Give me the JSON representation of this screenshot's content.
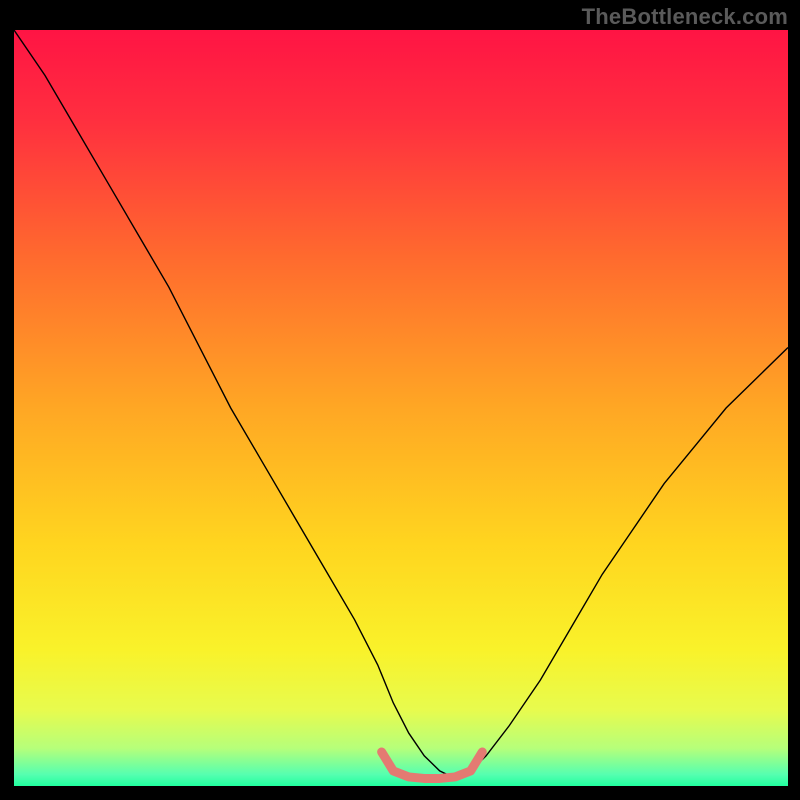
{
  "watermark": "TheBottleneck.com",
  "chart_data": {
    "type": "line",
    "title": "",
    "xlabel": "",
    "ylabel": "",
    "xlim": [
      0,
      100
    ],
    "ylim": [
      0,
      100
    ],
    "legend": null,
    "grid": false,
    "background_gradient": {
      "orientation": "vertical",
      "stops": [
        {
          "offset": 0.0,
          "color": "#ff1444"
        },
        {
          "offset": 0.12,
          "color": "#ff2f3f"
        },
        {
          "offset": 0.3,
          "color": "#ff6a2e"
        },
        {
          "offset": 0.5,
          "color": "#ffa724"
        },
        {
          "offset": 0.68,
          "color": "#ffd51f"
        },
        {
          "offset": 0.82,
          "color": "#f9f22a"
        },
        {
          "offset": 0.9,
          "color": "#e7fb4e"
        },
        {
          "offset": 0.95,
          "color": "#b6ff7a"
        },
        {
          "offset": 0.985,
          "color": "#55ffb0"
        },
        {
          "offset": 1.0,
          "color": "#21ff9f"
        }
      ]
    },
    "series": [
      {
        "name": "bottleneck-curve",
        "color": "#000000",
        "stroke_width": 1.4,
        "x": [
          0,
          4,
          8,
          12,
          16,
          20,
          24,
          28,
          32,
          36,
          40,
          44,
          47,
          49,
          51,
          53,
          55,
          57,
          59,
          61,
          64,
          68,
          72,
          76,
          80,
          84,
          88,
          92,
          96,
          100
        ],
        "values": [
          100,
          94,
          87,
          80,
          73,
          66,
          58,
          50,
          43,
          36,
          29,
          22,
          16,
          11,
          7,
          4,
          2,
          1,
          2,
          4,
          8,
          14,
          21,
          28,
          34,
          40,
          45,
          50,
          54,
          58
        ]
      },
      {
        "name": "sweet-spot-band",
        "color": "#e47a72",
        "stroke_width": 9,
        "linecap": "round",
        "x": [
          47.5,
          49,
          51,
          53,
          55,
          57,
          59,
          60.5
        ],
        "values": [
          4.5,
          2,
          1.2,
          1,
          1,
          1.2,
          2,
          4.5
        ]
      }
    ]
  }
}
